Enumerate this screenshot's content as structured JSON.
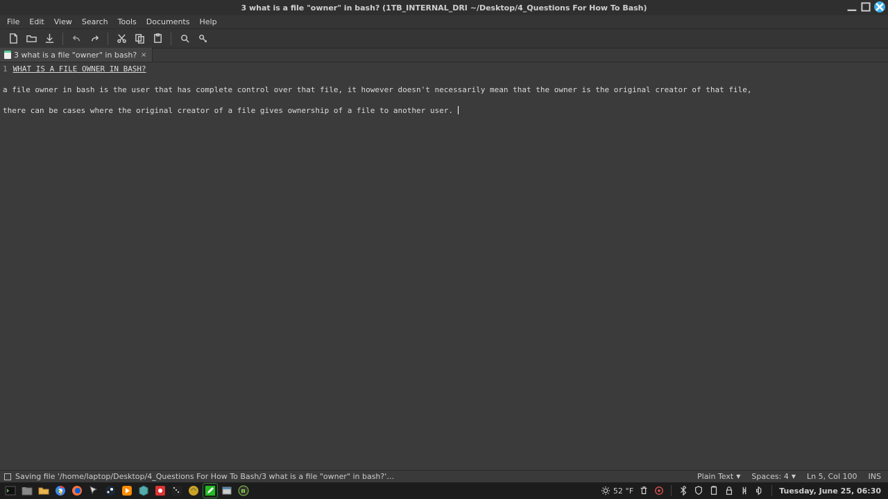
{
  "window": {
    "title": "3 what is a file \"owner\" in bash? (1TB_INTERNAL_DRI ~/Desktop/4_Questions For How To Bash)"
  },
  "menubar": {
    "items": [
      "File",
      "Edit",
      "View",
      "Search",
      "Tools",
      "Documents",
      "Help"
    ]
  },
  "tabs": [
    {
      "label": "3 what is a file \"owner\" in bash?"
    }
  ],
  "editor": {
    "line_number": "1",
    "line1_underlined": "WHAT IS A FILE OWNER IN BASH?",
    "line2": "",
    "line3": "a file owner in bash is the user that has complete control over that file, it however doesn't necessarily mean that the owner is the original creator of that file,",
    "line4": "",
    "line5": "there can be cases where the original creator of a file gives ownership of a file to another user. "
  },
  "statusbar": {
    "message": "Saving file '/home/laptop/Desktop/4_Questions For How To Bash/3 what is a file \"owner\" in bash?'…",
    "language": "Plain Text",
    "spaces": "Spaces: 4",
    "position": "Ln 5, Col 100",
    "mode": "INS"
  },
  "taskbar": {
    "weather_temp": "52 °F",
    "clock": "Tuesday, June 25, 06:30"
  },
  "icons": {
    "new": "new-file-icon",
    "open": "open-folder-icon",
    "save": "save-icon",
    "undo": "undo-icon",
    "redo": "redo-icon",
    "cut": "cut-icon",
    "copy": "copy-icon",
    "paste": "paste-icon",
    "search": "search-icon",
    "replace": "replace-icon"
  }
}
